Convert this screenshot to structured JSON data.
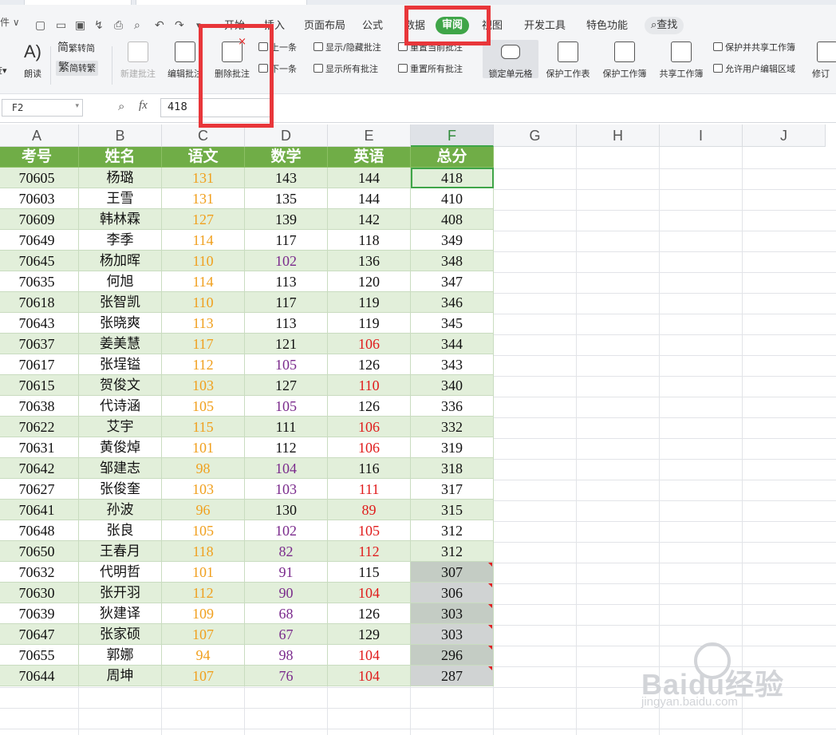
{
  "quick_access": {
    "file_menu": "件",
    "chevron": "▾"
  },
  "tabs": [
    {
      "label": "开始"
    },
    {
      "label": "插入"
    },
    {
      "label": "页面布局"
    },
    {
      "label": "公式"
    },
    {
      "label": "数据"
    },
    {
      "label": "审阅"
    },
    {
      "label": "视图"
    },
    {
      "label": "开发工具"
    },
    {
      "label": "特色功能"
    },
    {
      "label": "查找"
    }
  ],
  "ribbon": {
    "cut_partial": "查",
    "read_aloud": "朗读",
    "trad_to_simp": "繁转简",
    "simp_to_trad": "简转繁",
    "new_comment": "新建批注",
    "edit_comment": "编辑批注",
    "delete_comment": "删除批注",
    "prev_comment": "上一条",
    "next_comment": "下一条",
    "show_hide_comment": "显示/隐藏批注",
    "show_all_comments": "显示所有批注",
    "reset_current_comment": "重置当前批注",
    "reset_all_comments": "重置所有批注",
    "lock_cell": "锁定单元格",
    "protect_sheet": "保护工作表",
    "protect_workbook": "保护工作簿",
    "share_workbook": "共享工作簿",
    "protect_and_share": "保护并共享工作簿",
    "allow_edit_ranges": "允许用户编辑区域",
    "track_changes": "修订"
  },
  "formula_bar": {
    "name_box": "F2",
    "fx": "fx",
    "value": "418"
  },
  "columns": [
    "A",
    "B",
    "C",
    "D",
    "E",
    "F",
    "G",
    "H",
    "I",
    "J"
  ],
  "table": {
    "headers": [
      "考号",
      "姓名",
      "语文",
      "数学",
      "英语",
      "总分"
    ],
    "rows": [
      [
        "70605",
        "杨璐",
        "131",
        "143",
        "144",
        "418"
      ],
      [
        "70603",
        "王雪",
        "131",
        "135",
        "144",
        "410"
      ],
      [
        "70609",
        "韩林霖",
        "127",
        "139",
        "142",
        "408"
      ],
      [
        "70649",
        "李季",
        "114",
        "117",
        "118",
        "349"
      ],
      [
        "70645",
        "杨加晖",
        "110",
        "102",
        "136",
        "348"
      ],
      [
        "70635",
        "何旭",
        "114",
        "113",
        "120",
        "347"
      ],
      [
        "70618",
        "张智凯",
        "110",
        "117",
        "119",
        "346"
      ],
      [
        "70643",
        "张晓爽",
        "113",
        "113",
        "119",
        "345"
      ],
      [
        "70637",
        "姜美慧",
        "117",
        "121",
        "106",
        "344"
      ],
      [
        "70617",
        "张埕镒",
        "112",
        "105",
        "126",
        "343"
      ],
      [
        "70615",
        "贺俊文",
        "103",
        "127",
        "110",
        "340"
      ],
      [
        "70638",
        "代诗涵",
        "105",
        "105",
        "126",
        "336"
      ],
      [
        "70622",
        "艾宇",
        "115",
        "111",
        "106",
        "332"
      ],
      [
        "70631",
        "黄俊焯",
        "101",
        "112",
        "106",
        "319"
      ],
      [
        "70642",
        "邹建志",
        "98",
        "104",
        "116",
        "318"
      ],
      [
        "70627",
        "张俊奎",
        "103",
        "103",
        "111",
        "317"
      ],
      [
        "70641",
        "孙波",
        "96",
        "130",
        "89",
        "315"
      ],
      [
        "70648",
        "张良",
        "105",
        "102",
        "105",
        "312"
      ],
      [
        "70650",
        "王春月",
        "118",
        "82",
        "112",
        "312"
      ],
      [
        "70632",
        "代明哲",
        "101",
        "91",
        "115",
        "307"
      ],
      [
        "70630",
        "张开羽",
        "112",
        "90",
        "104",
        "306"
      ],
      [
        "70639",
        "狄建译",
        "109",
        "68",
        "126",
        "303"
      ],
      [
        "70647",
        "张家硕",
        "107",
        "67",
        "129",
        "303"
      ],
      [
        "70655",
        "郭娜",
        "94",
        "98",
        "104",
        "296"
      ],
      [
        "70644",
        "周坤",
        "107",
        "76",
        "104",
        "287"
      ]
    ],
    "math_purple_rows": [
      4,
      9,
      11,
      14,
      15,
      17,
      18,
      19,
      20,
      21,
      22,
      23,
      24
    ],
    "eng_red_rows": [
      8,
      10,
      12,
      13,
      15,
      16,
      17,
      18,
      20,
      23,
      24
    ],
    "total_gray_rows": [
      19,
      20,
      21,
      22,
      23,
      24
    ],
    "comment_flag_rows": [
      19,
      20,
      21,
      22,
      23,
      24
    ]
  },
  "colors": {
    "header_green": "#70ad47",
    "band_green": "#e2efda",
    "chinese_orange": "#f0a01e",
    "math_purple": "#7a2a8c",
    "english_red": "#e01b1b",
    "active_tab": "#3fa548",
    "highlight_red": "#e8363a"
  },
  "watermark": {
    "brand": "Baidu经验",
    "url": "jingyan.baidu.com"
  }
}
